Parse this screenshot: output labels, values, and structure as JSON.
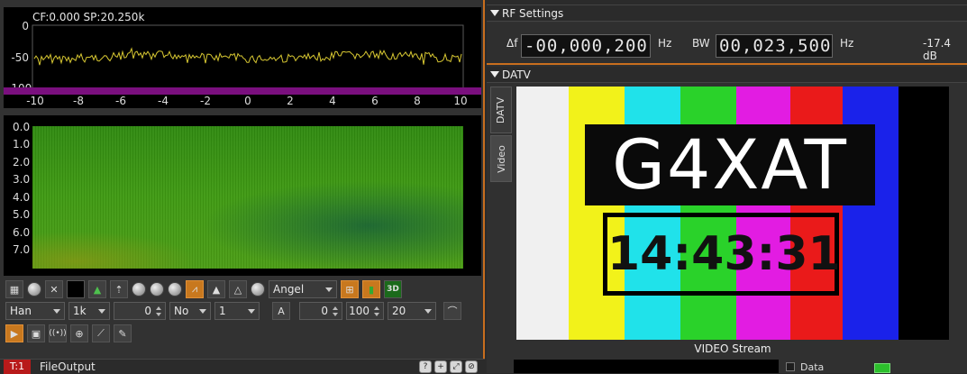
{
  "spectrum": {
    "info": "CF:0.000 SP:20.250k",
    "y_labels": [
      "0",
      "-50",
      "-100"
    ],
    "x_labels": [
      "-10",
      "-8",
      "-6",
      "-4",
      "-2",
      "0",
      "2",
      "4",
      "6",
      "8",
      "10"
    ]
  },
  "waterfall": {
    "y_labels": [
      "0.0",
      "1.0",
      "2.0",
      "3.0",
      "4.0",
      "5.0",
      "6.0",
      "7.0"
    ]
  },
  "toolbar1": {
    "palette_select": "Angel",
    "threed_label": "3D"
  },
  "toolbar2": {
    "window_select": "Han",
    "fft_size_select": "1k",
    "offset_value": "0",
    "averaging_mode_select": "No",
    "averaging_value_select": "1",
    "avg_button_label": "A",
    "ref_level_value": "0",
    "range_value": "100",
    "fps_select": "20"
  },
  "rf_settings": {
    "section_title": "RF Settings",
    "delta_f_label": "Δf",
    "delta_f_sign": "-",
    "delta_f_digits_dim": "00,000,",
    "delta_f_digits_bright": "200",
    "delta_f_unit": "Hz",
    "bw_label": "BW",
    "bw_digits_dim": "00,0",
    "bw_digits_bright": "23,500",
    "bw_unit": "Hz",
    "power_readout": "-17.4 dB"
  },
  "datv": {
    "section_title": "DATV",
    "tabs": [
      "DATV",
      "Video"
    ],
    "active_tab": "Video",
    "callsign": "G4XAT",
    "clock": "14:43:31",
    "stream_label": "VIDEO Stream",
    "bottom_label": "Data"
  },
  "bottom_device": {
    "badge": "T:1",
    "label": "FileOutput"
  },
  "colors": {
    "accent_orange": "#c86e1e",
    "spectrum_trace": "#d8c832",
    "purple_bar": "#7a0f7e"
  }
}
